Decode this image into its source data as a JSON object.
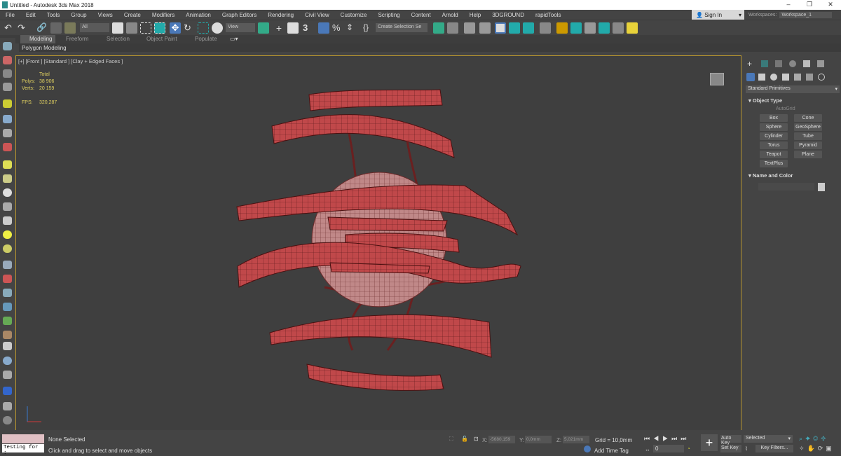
{
  "window": {
    "title": "Untitled - Autodesk 3ds Max 2018",
    "minimize": "–",
    "restore": "❐",
    "close": "✕"
  },
  "menu": [
    "File",
    "Edit",
    "Tools",
    "Group",
    "Views",
    "Create",
    "Modifiers",
    "Animation",
    "Graph Editors",
    "Rendering",
    "Civil View",
    "Customize",
    "Scripting",
    "Content",
    "Arnold",
    "Help",
    "3DGROUND",
    "rapidTools"
  ],
  "account": {
    "sign_in": "Sign In",
    "workspaces_label": "Workspaces:",
    "workspace": "Workspace_1"
  },
  "toolbar": {
    "selection_filter": "All",
    "ref_coord": "View",
    "selection_set": "Create Selection Se",
    "snap_label": "3"
  },
  "ribbon": {
    "tabs": [
      "Modeling",
      "Freeform",
      "Selection",
      "Object Paint",
      "Populate"
    ],
    "active": "Modeling",
    "panel": "Polygon Modeling"
  },
  "viewport": {
    "label": "[+] [Front ] [Standard ] [Clay + Edged Faces ]",
    "stats": {
      "total": "Total",
      "polys_label": "Polys:",
      "polys": "38 906",
      "verts_label": "Verts:",
      "verts": "20 159",
      "fps_label": "FPS:",
      "fps": "320,287"
    },
    "model_color": "#c0484a"
  },
  "command_panel": {
    "category": "Standard Primitives",
    "object_type": "Object Type",
    "autogrid": "AutoGrid",
    "buttons": [
      "Box",
      "Cone",
      "Sphere",
      "GeoSphere",
      "Cylinder",
      "Tube",
      "Torus",
      "Pyramid",
      "Teapot",
      "Plane",
      "TextPlus"
    ],
    "name_and_color": "Name and Color"
  },
  "status": {
    "script": "Testing for :",
    "selected": "None Selected",
    "prompt": "Click and drag to select and move objects",
    "x_label": "X:",
    "x": "-5680,159",
    "y_label": "Y:",
    "y": "0,0mm",
    "z_label": "Z:",
    "z": "5,021mm",
    "grid": "Grid = 10,0mm",
    "add_time_tag": "Add Time Tag",
    "frame": "0",
    "auto_key": "Auto Key",
    "set_key": "Set Key",
    "key_mode": "Selected",
    "key_filters": "Key Filters..."
  }
}
